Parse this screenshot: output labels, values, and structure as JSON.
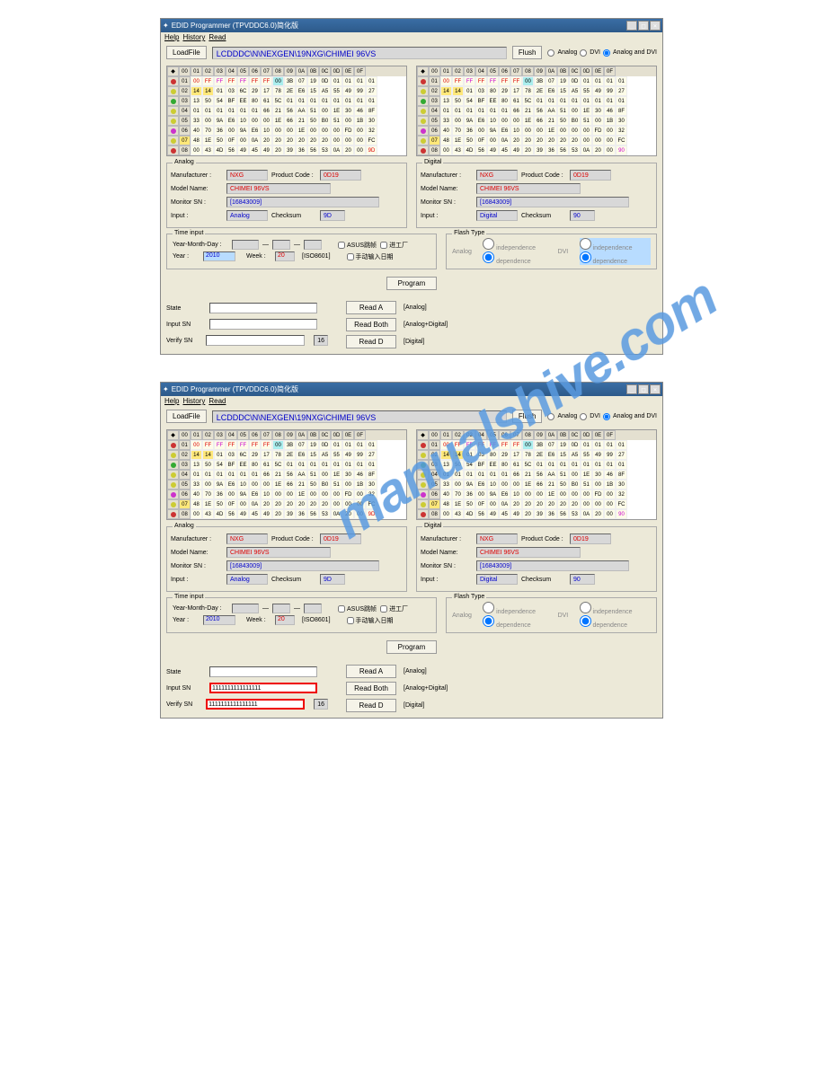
{
  "title": "EDID Programmer (TPVDDC6.0)简化版",
  "menu": {
    "help": "Help",
    "history": "History",
    "read": "Read"
  },
  "toolbar": {
    "loadfile": "LoadFile",
    "path": "LCDDDC\\N\\NEXGEN\\19NXG\\CHIMEI 96VS",
    "flush": "Flush",
    "r1": "Analog",
    "r2": "DVI",
    "r3": "Analog and DVI"
  },
  "hexheaders": [
    "00",
    "01",
    "02",
    "03",
    "04",
    "05",
    "06",
    "07",
    "08",
    "09",
    "0A",
    "0B",
    "0C",
    "0D",
    "0E",
    "0F"
  ],
  "hexrows": [
    "00",
    "01",
    "02",
    "03",
    "04",
    "05",
    "06",
    "07",
    "08"
  ],
  "analog": {
    "title": "Analog",
    "mfr_lbl": "Manufacturer :",
    "mfr": "NXG",
    "pcode_lbl": "Product Code :",
    "pcode": "0D19",
    "model_lbl": "Model Name:",
    "model": "CHIMEI 96VS",
    "sn_lbl": "Monitor SN :",
    "sn": "[16843009]",
    "input_lbl": "Input :",
    "input": "Analog",
    "cksum_lbl": "Checksum",
    "cksum": "9D"
  },
  "digital": {
    "title": "Digital",
    "mfr_lbl": "Manufacturer :",
    "mfr": "NXG",
    "pcode_lbl": "Product Code :",
    "pcode": "0D19",
    "model_lbl": "Model Name:",
    "model": "CHIMEI 96VS",
    "sn_lbl": "Monitor SN :",
    "sn": "[16843009]",
    "input_lbl": "Input :",
    "input": "Digital",
    "cksum_lbl": "Checksum",
    "cksum": "90"
  },
  "time": {
    "title": "Time input",
    "ymd": "Year-Month-Day :",
    "year_lbl": "Year :",
    "year": "2010",
    "week_lbl": "Week :",
    "week": "20",
    "iso": "[ISO8601]",
    "ck1": "ASUS跳帧",
    "ck2": "进工厂",
    "ck3": "手动输入日期"
  },
  "flash": {
    "title": "Flash Type",
    "analog": "Analog",
    "dvi": "DVI",
    "independ": "independence",
    "depend": "dependence"
  },
  "actions": {
    "program": "Program",
    "reada": "Read A",
    "a": "[Analog]",
    "readboth": "Read Both",
    "b": "[Analog+Digital]",
    "readd": "Read D",
    "d": "[Digital]"
  },
  "sn": {
    "state": "State",
    "input": "Input SN",
    "verify": "Verify SN",
    "len": "16"
  },
  "win2": {
    "sn_input": "1111111111111111",
    "sn_verify": "1111111111111111"
  },
  "watermark": "manualshive.com"
}
